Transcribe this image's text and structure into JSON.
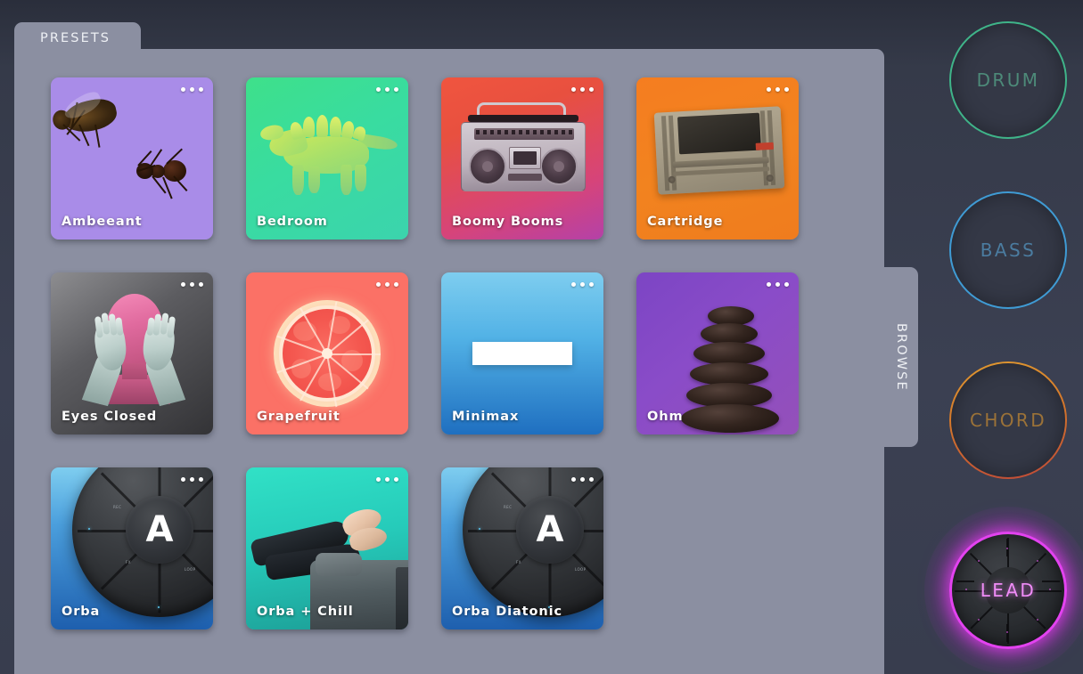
{
  "app": {
    "panel_tab_label": "PRESETS",
    "browse_tab_label": "BROWSE"
  },
  "presets": [
    {
      "name": "Ambeeant",
      "artwork": "bee-and-ant",
      "menu_icon": "more-options-icon",
      "accent": "#a98ce8"
    },
    {
      "name": "Bedroom",
      "artwork": "stegosaurus-toy",
      "menu_icon": "more-options-icon",
      "accent": "#3ad79b"
    },
    {
      "name": "Boomy Booms",
      "artwork": "boombox",
      "menu_icon": "more-options-icon",
      "accent": "#d6447a"
    },
    {
      "name": "Cartridge",
      "artwork": "game-cartridge",
      "menu_icon": "more-options-icon",
      "accent": "#f2831f"
    },
    {
      "name": "Eyes Closed",
      "artwork": "head-covering-eyes",
      "menu_icon": "more-options-icon",
      "accent": "#5c5c60"
    },
    {
      "name": "Grapefruit",
      "artwork": "grapefruit-slice",
      "menu_icon": "more-options-icon",
      "accent": "#fb7166"
    },
    {
      "name": "Minimax",
      "artwork": "white-bar",
      "menu_icon": "more-options-icon",
      "accent": "#52b2e6"
    },
    {
      "name": "Ohm",
      "artwork": "stacked-stones",
      "menu_icon": "more-options-icon",
      "accent": "#8a4cc8"
    },
    {
      "name": "Orba",
      "artwork": "orba-device",
      "menu_icon": "more-options-icon",
      "accent": "#1e5fae"
    },
    {
      "name": "Orba + Chill",
      "artwork": "legs-on-couch",
      "menu_icon": "more-options-icon",
      "accent": "#24c9b8"
    },
    {
      "name": "Orba Diatonic",
      "artwork": "orba-device",
      "menu_icon": "more-options-icon",
      "accent": "#1e5fae"
    }
  ],
  "sound_buttons": [
    {
      "label": "DRUM",
      "color": "#3fb489",
      "active": false
    },
    {
      "label": "BASS",
      "color": "#3f9bd4",
      "active": false
    },
    {
      "label": "CHORD",
      "color": "#d4772b",
      "active": false
    },
    {
      "label": "LEAD",
      "color": "#e342f0",
      "active": true
    }
  ]
}
